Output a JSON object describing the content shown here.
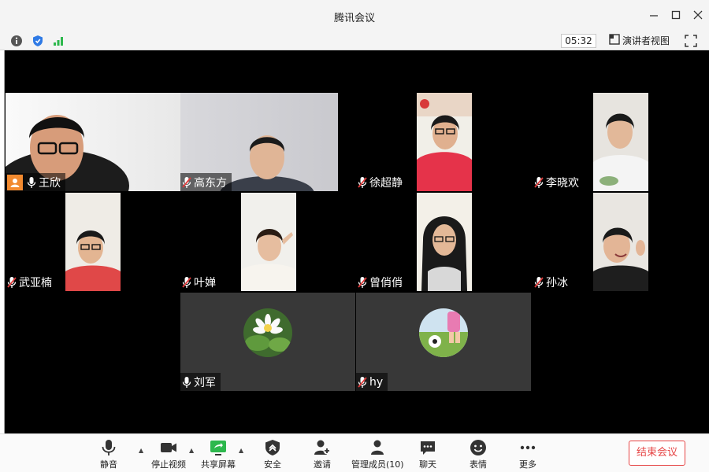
{
  "window": {
    "title": "腾讯会议"
  },
  "status": {
    "timer": "05:32",
    "speaker_view": "演讲者视图"
  },
  "participants": [
    {
      "name": "王欣",
      "muted": false,
      "host": true
    },
    {
      "name": "高东方",
      "muted": true
    },
    {
      "name": "徐超静",
      "muted": true
    },
    {
      "name": "李晓欢",
      "muted": true
    },
    {
      "name": "武亚楠",
      "muted": true
    },
    {
      "name": "叶婵",
      "muted": true
    },
    {
      "name": "曾俏俏",
      "muted": true
    },
    {
      "name": "孙冰",
      "muted": true
    },
    {
      "name": "刘军",
      "muted": false
    },
    {
      "name": "hy",
      "muted": true
    }
  ],
  "toolbar": {
    "mute": "静音",
    "stop_video": "停止视频",
    "share_screen": "共享屏幕",
    "security": "安全",
    "invite": "邀请",
    "manage_members": "管理成员(10)",
    "chat": "聊天",
    "reactions": "表情",
    "more": "更多",
    "end_meeting": "结束会议"
  },
  "colors": {
    "end_meeting": "#e64545",
    "host_badge": "#f28a2f",
    "mic_muted": "#e03c3c",
    "signal": "#2db84d"
  }
}
